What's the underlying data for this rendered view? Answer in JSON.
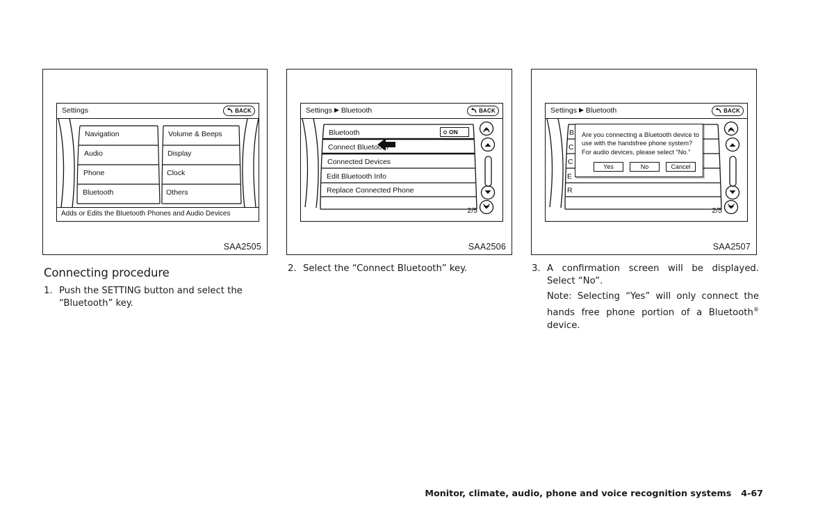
{
  "figures": [
    {
      "code": "SAA2505",
      "screen": {
        "title": "Settings",
        "back_label": "BACK",
        "menu_columns": [
          [
            "Navigation",
            "Audio",
            "Phone",
            "Bluetooth"
          ],
          [
            "Volume & Beeps",
            "Display",
            "Clock",
            "Others"
          ]
        ],
        "status_text": "Adds or Edits the Bluetooth Phones and Audio Devices"
      }
    },
    {
      "code": "SAA2506",
      "screen": {
        "title_root": "Settings",
        "title_leaf": "Bluetooth",
        "back_label": "BACK",
        "rows": [
          "Bluetooth",
          "Connect Bluetooth",
          "Connected Devices",
          "Edit Bluetooth Info",
          "Replace Connected Phone"
        ],
        "toggle_label": "ON",
        "page_indicator": "2/5",
        "selected_row": "Connect Bluetooth"
      }
    },
    {
      "code": "SAA2507",
      "screen": {
        "title_root": "Settings",
        "title_leaf": "Bluetooth",
        "back_label": "BACK",
        "obscured_rows": [
          "B",
          "C",
          "C",
          "E",
          "R"
        ],
        "page_indicator": "2/5",
        "dialog": {
          "message_lines": [
            "Are you connecting a Bluetooth device to",
            "use with the handsfree phone system?",
            "For audio devices, please select \"No.\""
          ],
          "buttons": [
            "Yes",
            "No",
            "Cancel"
          ]
        }
      }
    }
  ],
  "content": {
    "section_title": "Connecting procedure",
    "step1": {
      "num": "1.",
      "text": "Push the SETTING button and select the “Bluetooth” key."
    },
    "step2": {
      "num": "2.",
      "text": "Select the “Connect Bluetooth” key."
    },
    "step3": {
      "num": "3.",
      "text": "A confirmation screen will be displayed. Select “No”.",
      "note_part1": "Note: Selecting “Yes” will only connect the hands free phone portion of a Bluetooth",
      "note_part2": " device."
    }
  },
  "footer": {
    "chapter": "Monitor, climate, audio, phone and voice recognition systems",
    "page": "4-67"
  },
  "colors": {
    "ink": "#1a1a1a",
    "paper": "#ffffff"
  }
}
